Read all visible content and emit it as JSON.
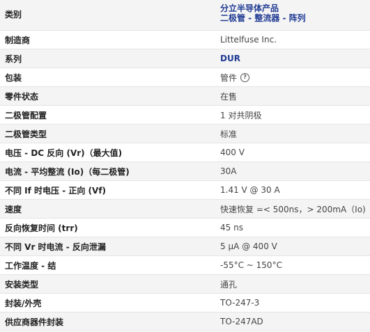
{
  "rows": [
    {
      "label": "类别",
      "value_lines": [
        "分立半导体产品",
        "二极管 - 整流器 - 阵列"
      ]
    },
    {
      "label": "制造商",
      "value": "Littelfuse Inc."
    },
    {
      "label": "系列",
      "value": "DUR"
    },
    {
      "label": "包装",
      "value": "管件",
      "icon": "help-icon",
      "icon_glyph": "?"
    },
    {
      "label": "零件状态",
      "value": "在售"
    },
    {
      "label": "二极管配置",
      "value": "1 对共阴极"
    },
    {
      "label": "二极管类型",
      "value": "标准"
    },
    {
      "label": "电压 - DC 反向 (Vr)（最大值)",
      "value": "400 V"
    },
    {
      "label": "电流 - 平均整流 (Io)（每二极管)",
      "value": "30A"
    },
    {
      "label": "不同 If 时电压 - 正向 (Vf)",
      "value": "1.41 V @ 30 A"
    },
    {
      "label": "速度",
      "value": "快速恢复 =< 500ns，> 200mA（Io)"
    },
    {
      "label": "反向恢复时间 (trr)",
      "value": "45 ns"
    },
    {
      "label": "不同 Vr 时电流 - 反向泄漏",
      "value": "5 µA @ 400 V"
    },
    {
      "label": "工作温度 - 结",
      "value": "-55°C ~ 150°C"
    },
    {
      "label": "安装类型",
      "value": "通孔"
    },
    {
      "label": "封装/外壳",
      "value": "TO-247-3"
    },
    {
      "label": "供应商器件封装",
      "value": "TO-247AD"
    }
  ],
  "colors": {
    "link": "#1f3a93",
    "row_alt": "#f4f4f4"
  }
}
